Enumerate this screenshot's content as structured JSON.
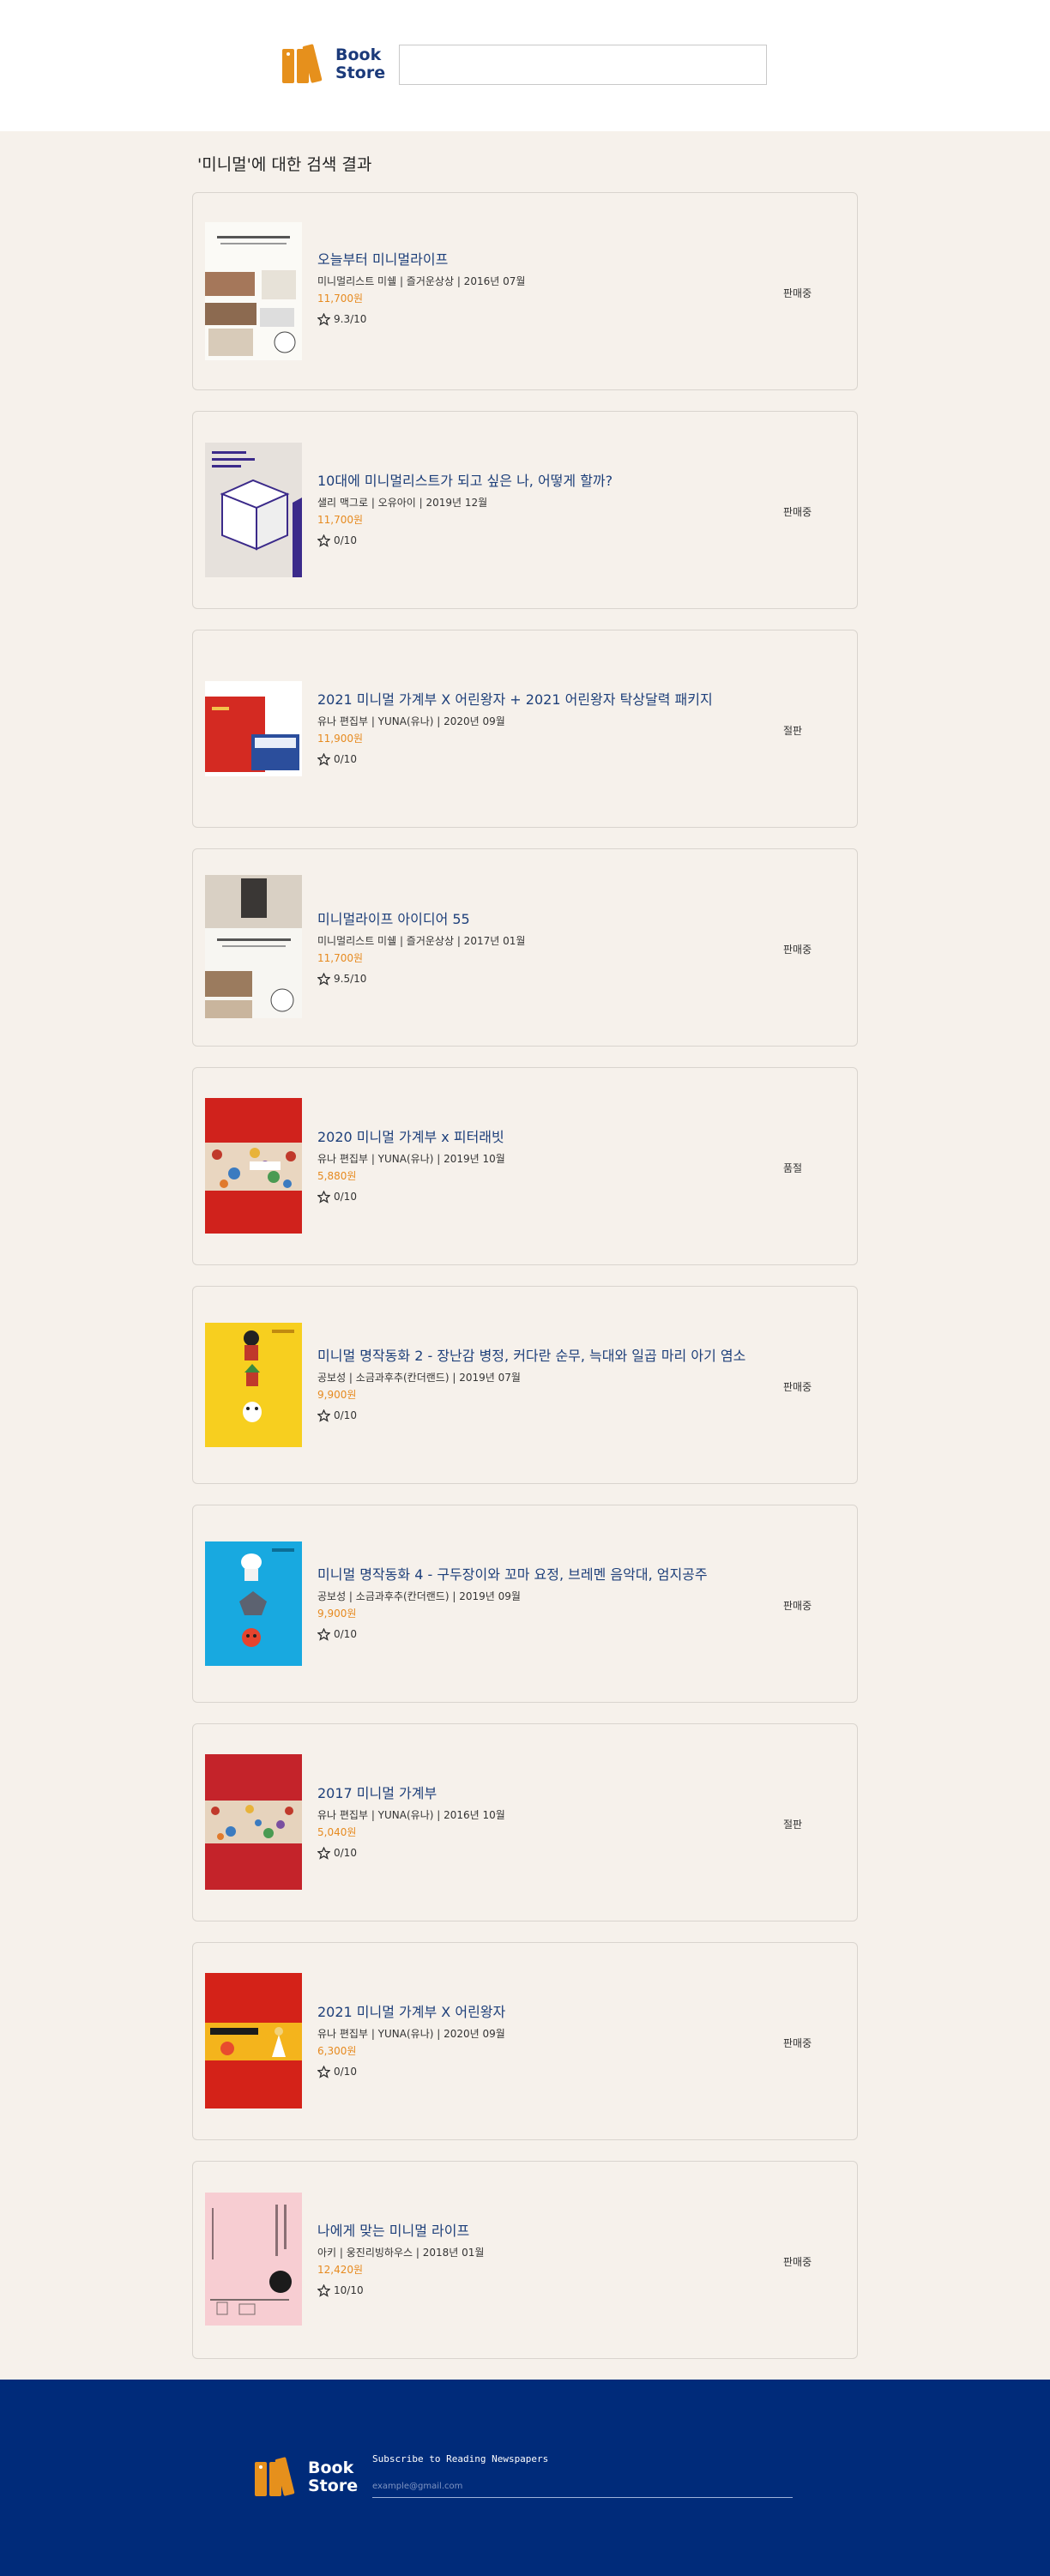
{
  "header": {
    "logo_line1": "Book",
    "logo_line2": "Store",
    "search_value": ""
  },
  "results": {
    "title": "'미니멀'에 대한 검색 결과",
    "books": [
      {
        "title": "오늘부터 미니멀라이프",
        "meta": "미니멀리스트 미쉘 | 즐거운상상 | 2016년 07월",
        "price": "11,700원",
        "rating": "9.3/10",
        "status": "판매중"
      },
      {
        "title": "10대에 미니멀리스트가 되고 싶은 나, 어떻게 할까?",
        "meta": "샐리 맥그로 | 오유아이 | 2019년 12월",
        "price": "11,700원",
        "rating": "0/10",
        "status": "판매중"
      },
      {
        "title": "2021 미니멀 가계부 X 어린왕자 + 2021 어린왕자 탁상달력 패키지",
        "meta": "유나 편집부 | YUNA(유나) | 2020년 09월",
        "price": "11,900원",
        "rating": "0/10",
        "status": "절판"
      },
      {
        "title": "미니멀라이프 아이디어 55",
        "meta": "미니멀리스트 미쉘 | 즐거운상상 | 2017년 01월",
        "price": "11,700원",
        "rating": "9.5/10",
        "status": "판매중"
      },
      {
        "title": "2020 미니멀 가계부 x 피터래빗",
        "meta": "유나 편집부 | YUNA(유나) | 2019년 10월",
        "price": "5,880원",
        "rating": "0/10",
        "status": "품절"
      },
      {
        "title": "미니멀 명작동화 2 - 장난감 병정, 커다란 순무, 늑대와 일곱 마리 아기 염소",
        "meta": "공보성 | 소금과후추(칸더랜드) | 2019년 07월",
        "price": "9,900원",
        "rating": "0/10",
        "status": "판매중"
      },
      {
        "title": "미니멀 명작동화 4 - 구두장이와 꼬마 요정, 브레멘 음악대, 엄지공주",
        "meta": "공보성 | 소금과후추(칸더랜드) | 2019년 09월",
        "price": "9,900원",
        "rating": "0/10",
        "status": "판매중"
      },
      {
        "title": "2017 미니멀 가계부",
        "meta": "유나 편집부 | YUNA(유나) | 2016년 10월",
        "price": "5,040원",
        "rating": "0/10",
        "status": "절판"
      },
      {
        "title": "2021 미니멀 가계부 X 어린왕자",
        "meta": "유나 편집부 | YUNA(유나) | 2020년 09월",
        "price": "6,300원",
        "rating": "0/10",
        "status": "판매중"
      },
      {
        "title": "나에게 맞는 미니멀 라이프",
        "meta": "아키 | 웅진리빙하우스 | 2018년 01월",
        "price": "12,420원",
        "rating": "10/10",
        "status": "판매중"
      }
    ]
  },
  "footer": {
    "logo_line1": "Book",
    "logo_line2": "Store",
    "subscribe_label": "Subscribe to Reading Newspapers",
    "email_placeholder": "example@gmail.com"
  }
}
